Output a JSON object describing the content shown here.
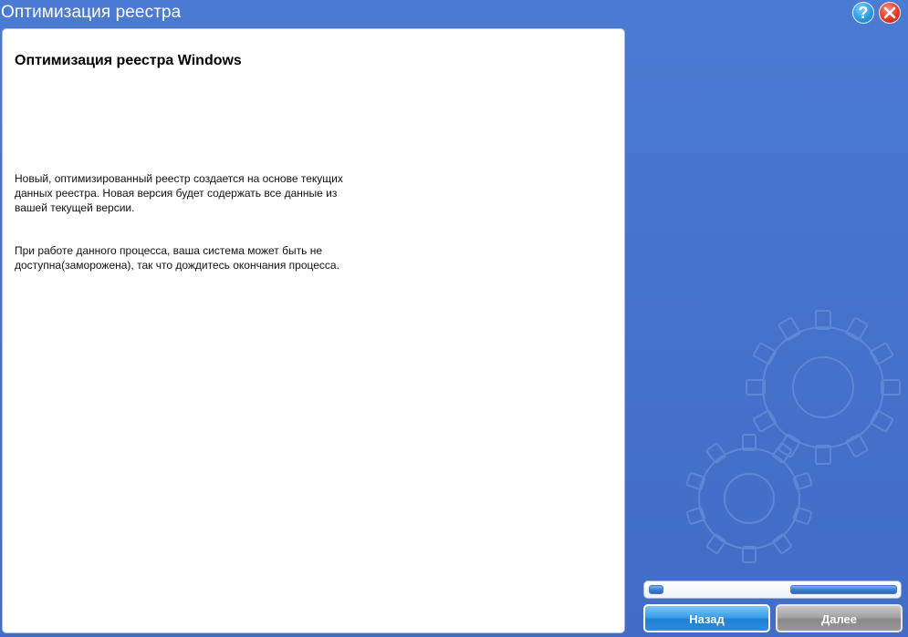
{
  "window": {
    "title": "Оптимизация реестра"
  },
  "titlebar": {
    "help_glyph": "?",
    "help_icon": "question-mark-icon",
    "close_icon": "close-x-icon"
  },
  "content": {
    "heading": "Оптимизация реестра Windows",
    "paragraph_1": "Новый, оптимизированный реестр создается на основе текущих\nданных реестра. Новая версия будет содержать все данные из\nвашей текущей версии.",
    "paragraph_2": "При работе данного процесса, ваша система может быть не\nдоступна(заморожена), так что дождитесь окончания процесса."
  },
  "decor": {
    "icon": "gears-icon"
  },
  "footer": {
    "back_label": "Назад",
    "next_label": "Далее"
  },
  "colors": {
    "background": "#4170c8",
    "back_button": "#2a8ee0",
    "next_button": "#979797",
    "close_button": "#e43a25",
    "help_button": "#2a9be8"
  }
}
